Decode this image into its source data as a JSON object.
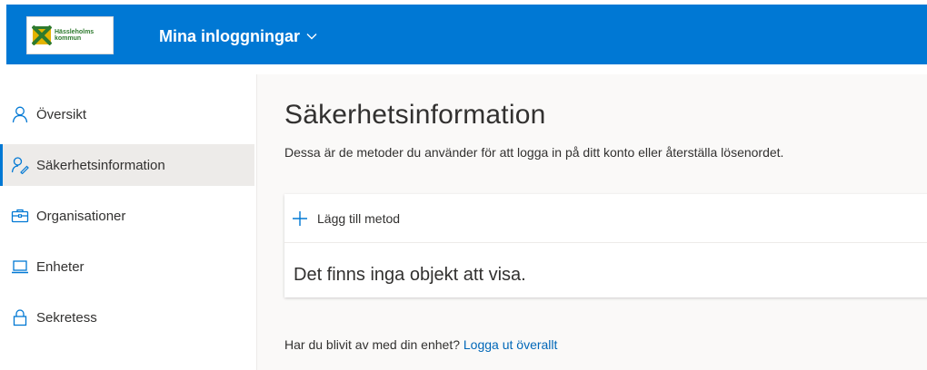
{
  "header": {
    "logo_text": "Hässleholms\nkommun",
    "app_title": "Mina inloggningar",
    "colors": {
      "accent": "#0078d4",
      "logo_green": "#2e7a2e",
      "logo_yellow": "#e3b400"
    }
  },
  "sidebar": {
    "items": [
      {
        "label": "Översikt",
        "icon": "person-icon",
        "active": false
      },
      {
        "label": "Säkerhetsinformation",
        "icon": "security-info-icon",
        "active": true
      },
      {
        "label": "Organisationer",
        "icon": "briefcase-icon",
        "active": false
      },
      {
        "label": "Enheter",
        "icon": "laptop-icon",
        "active": false
      },
      {
        "label": "Sekretess",
        "icon": "lock-icon",
        "active": false
      }
    ]
  },
  "main": {
    "title": "Säkerhetsinformation",
    "description": "Dessa är de metoder du använder för att logga in på ditt konto eller återställa lösenordet.",
    "add_method_label": "Lägg till metod",
    "empty_text": "Det finns inga objekt att visa.",
    "lost_device_text": "Har du blivit av med din enhet?",
    "sign_out_link": "Logga ut överallt"
  }
}
